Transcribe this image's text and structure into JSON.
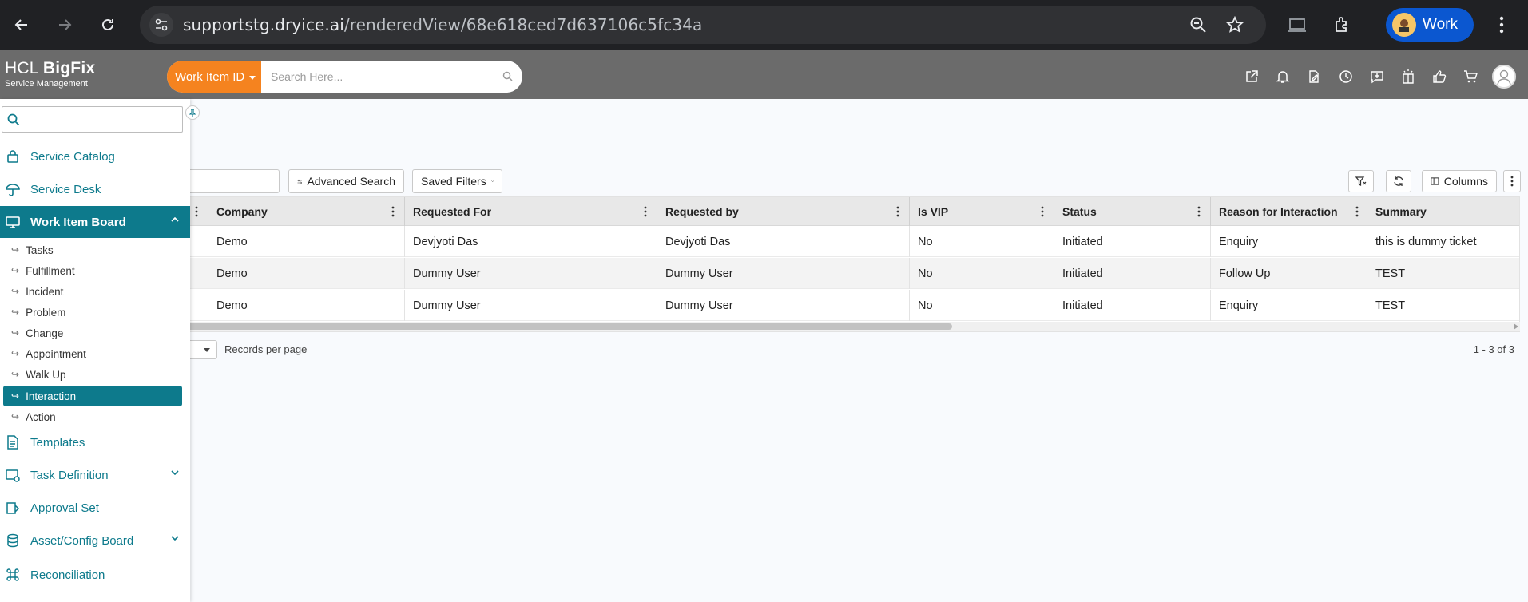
{
  "browser": {
    "url_host": "supportstg.dryice.ai",
    "url_path": "/renderedView/68e618ced7d637106c5fc34a",
    "profile_label": "Work"
  },
  "app": {
    "brand_name_light": "HCL ",
    "brand_name_bold": "BigFix",
    "brand_subtitle": "Service Management",
    "search_filter_label": "Work Item ID",
    "search_placeholder": "Search Here..."
  },
  "sidebar": {
    "search_placeholder": "",
    "items": [
      {
        "label": "Service Catalog",
        "icon": "bag-icon"
      },
      {
        "label": "Service Desk",
        "icon": "umbrella-icon"
      },
      {
        "label": "Work Item Board",
        "icon": "monitor-icon",
        "active": true,
        "expanded": true
      },
      {
        "label": "Templates",
        "icon": "document-icon"
      },
      {
        "label": "Task Definition",
        "icon": "task-settings-icon"
      },
      {
        "label": "Approval Set",
        "icon": "approval-icon"
      },
      {
        "label": "Asset/Config Board",
        "icon": "database-icon"
      },
      {
        "label": "Reconciliation",
        "icon": "command-icon"
      }
    ],
    "subitems": [
      "Tasks",
      "Fulfillment",
      "Incident",
      "Problem",
      "Change",
      "Appointment",
      "Walk Up",
      "Interaction",
      "Action"
    ],
    "active_subitem": "Interaction"
  },
  "toolbar": {
    "advanced_search": "Advanced Search",
    "saved_filters": "Saved Filters",
    "columns": "Columns"
  },
  "table": {
    "columns": [
      "Company",
      "Requested For",
      "Requested by",
      "Is VIP",
      "Status",
      "Reason for Interaction",
      "Summary"
    ],
    "rows": [
      [
        "Demo",
        "Devjyoti Das",
        "Devjyoti Das",
        "No",
        "Initiated",
        "Enquiry",
        "this is dummy ticket"
      ],
      [
        "Demo",
        "Dummy User",
        "Dummy User",
        "No",
        "Initiated",
        "Follow Up",
        "TEST"
      ],
      [
        "Demo",
        "Dummy User",
        "Dummy User",
        "No",
        "Initiated",
        "Enquiry",
        "TEST"
      ]
    ]
  },
  "pager": {
    "records_per_page": "Records per page",
    "count": "1 - 3 of 3"
  },
  "colors": {
    "accent_teal": "#0d7a8c",
    "filter_orange": "#f5831f",
    "header_gray": "#6b6b6b"
  }
}
